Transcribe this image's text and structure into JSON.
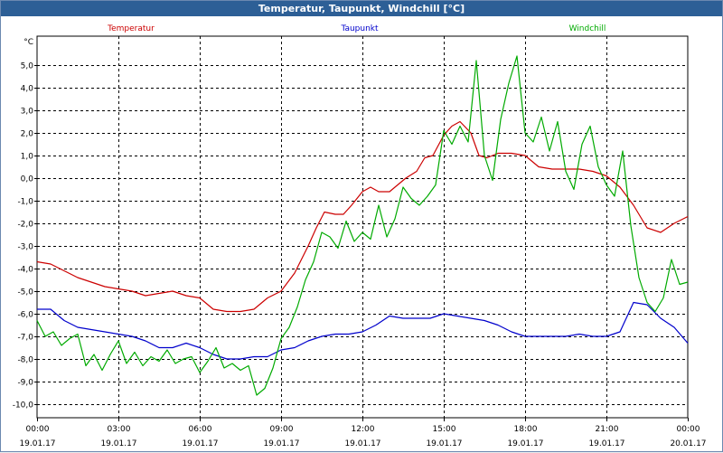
{
  "window": {
    "title": "Temperatur, Taupunkt, Windchill [°C]"
  },
  "chart_data": {
    "type": "line",
    "unit_label": "°C",
    "ylim": [
      -10.5,
      6
    ],
    "yticks": [
      5.0,
      4.0,
      3.0,
      2.0,
      1.0,
      0.0,
      -1.0,
      -2.0,
      -3.0,
      -4.0,
      -5.0,
      -6.0,
      -7.0,
      -8.0,
      -9.0,
      -10.0
    ],
    "ytick_labels": [
      "5,0",
      "4,0",
      "3,0",
      "2,0",
      "1,0",
      "0,0",
      "-1,0",
      "-2,0",
      "-3,0",
      "-4,0",
      "-5,0",
      "-6,0",
      "-7,0",
      "-8,0",
      "-9,0",
      "-10,0"
    ],
    "xlim": [
      0,
      24
    ],
    "xticks": [
      0,
      3,
      6,
      9,
      12,
      15,
      18,
      21,
      24
    ],
    "xtick_times": [
      "00:00",
      "03:00",
      "06:00",
      "09:00",
      "12:00",
      "15:00",
      "18:00",
      "21:00",
      "00:00"
    ],
    "xtick_dates": [
      "19.01.17",
      "19.01.17",
      "19.01.17",
      "19.01.17",
      "19.01.17",
      "19.01.17",
      "19.01.17",
      "19.01.17",
      "20.01.17"
    ],
    "grid": true,
    "legend_position": "top",
    "series": [
      {
        "name": "Temperatur",
        "color": "#cc0000",
        "x": [
          0,
          0.5,
          1,
          1.5,
          2,
          2.5,
          3,
          3.5,
          4,
          4.5,
          5,
          5.5,
          6,
          6.5,
          7,
          7.5,
          8,
          8.5,
          9,
          9.5,
          10,
          10.3,
          10.6,
          11,
          11.3,
          11.6,
          12,
          12.3,
          12.6,
          13,
          13.3,
          13.6,
          14,
          14.3,
          14.6,
          15,
          15.3,
          15.6,
          16,
          16.3,
          16.6,
          17,
          17.5,
          18,
          18.5,
          19,
          19.5,
          20,
          20.5,
          21,
          21.5,
          22,
          22.5,
          23,
          23.5,
          24
        ],
        "values": [
          -3.7,
          -3.8,
          -4.1,
          -4.4,
          -4.6,
          -4.8,
          -4.9,
          -5.0,
          -5.2,
          -5.1,
          -5.0,
          -5.2,
          -5.3,
          -5.8,
          -5.9,
          -5.9,
          -5.8,
          -5.3,
          -5.0,
          -4.2,
          -3.0,
          -2.2,
          -1.5,
          -1.6,
          -1.6,
          -1.2,
          -0.6,
          -0.4,
          -0.6,
          -0.6,
          -0.3,
          0.0,
          0.3,
          0.9,
          1.0,
          1.9,
          2.3,
          2.5,
          2.0,
          1.0,
          0.9,
          1.1,
          1.1,
          1.0,
          0.5,
          0.4,
          0.4,
          0.4,
          0.3,
          0.1,
          -0.4,
          -1.2,
          -2.2,
          -2.4,
          -2.0,
          -1.7
        ]
      },
      {
        "name": "Taupunkt",
        "color": "#0000cc",
        "x": [
          0,
          0.5,
          1,
          1.5,
          2,
          2.5,
          3,
          3.5,
          4,
          4.5,
          5,
          5.5,
          6,
          6.5,
          7,
          7.5,
          8,
          8.5,
          9,
          9.5,
          10,
          10.5,
          11,
          11.5,
          12,
          12.5,
          13,
          13.5,
          14,
          14.5,
          15,
          15.5,
          16,
          16.5,
          17,
          17.5,
          18,
          18.5,
          19,
          19.5,
          20,
          20.5,
          21,
          21.5,
          22,
          22.5,
          23,
          23.5,
          24
        ],
        "values": [
          -5.8,
          -5.8,
          -6.3,
          -6.6,
          -6.7,
          -6.8,
          -6.9,
          -7.0,
          -7.2,
          -7.5,
          -7.5,
          -7.3,
          -7.5,
          -7.8,
          -8.0,
          -8.0,
          -7.9,
          -7.9,
          -7.6,
          -7.5,
          -7.2,
          -7.0,
          -6.9,
          -6.9,
          -6.8,
          -6.5,
          -6.1,
          -6.2,
          -6.2,
          -6.2,
          -6.0,
          -6.1,
          -6.2,
          -6.3,
          -6.5,
          -6.8,
          -7.0,
          -7.0,
          -7.0,
          -7.0,
          -6.9,
          -7.0,
          -7.0,
          -6.8,
          -5.5,
          -5.6,
          -6.2,
          -6.6,
          -7.3
        ]
      },
      {
        "name": "Windchill",
        "color": "#00aa00",
        "x": [
          0,
          0.3,
          0.6,
          0.9,
          1.2,
          1.5,
          1.8,
          2.1,
          2.4,
          2.7,
          3.0,
          3.3,
          3.6,
          3.9,
          4.2,
          4.5,
          4.8,
          5.1,
          5.4,
          5.7,
          6.0,
          6.3,
          6.6,
          6.9,
          7.2,
          7.5,
          7.8,
          8.1,
          8.4,
          8.7,
          9.0,
          9.3,
          9.6,
          9.9,
          10.2,
          10.5,
          10.8,
          11.1,
          11.4,
          11.7,
          12.0,
          12.3,
          12.6,
          12.9,
          13.2,
          13.5,
          13.8,
          14.1,
          14.4,
          14.7,
          15.0,
          15.3,
          15.6,
          15.9,
          16.2,
          16.5,
          16.8,
          17.1,
          17.4,
          17.7,
          18.0,
          18.3,
          18.6,
          18.9,
          19.2,
          19.5,
          19.8,
          20.1,
          20.4,
          20.7,
          21.0,
          21.3,
          21.6,
          21.9,
          22.2,
          22.5,
          22.8,
          23.1,
          23.4,
          23.7,
          24.0
        ],
        "values": [
          -6.3,
          -7.0,
          -6.8,
          -7.4,
          -7.1,
          -6.9,
          -8.3,
          -7.8,
          -8.5,
          -7.8,
          -7.2,
          -8.2,
          -7.7,
          -8.3,
          -7.9,
          -8.1,
          -7.6,
          -8.2,
          -8.0,
          -7.9,
          -8.6,
          -8.1,
          -7.5,
          -8.4,
          -8.2,
          -8.5,
          -8.3,
          -9.6,
          -9.3,
          -8.4,
          -7.1,
          -6.6,
          -5.7,
          -4.5,
          -3.7,
          -2.4,
          -2.6,
          -3.1,
          -1.9,
          -2.8,
          -2.4,
          -2.7,
          -1.2,
          -2.6,
          -1.8,
          -0.4,
          -0.9,
          -1.2,
          -0.8,
          -0.3,
          2.1,
          1.5,
          2.3,
          1.6,
          5.2,
          1.0,
          -0.1,
          2.6,
          4.2,
          5.4,
          2.0,
          1.6,
          2.7,
          1.2,
          2.5,
          0.3,
          -0.5,
          1.5,
          2.3,
          0.5,
          -0.3,
          -0.8,
          1.2,
          -2.1,
          -4.4,
          -5.5,
          -5.9,
          -5.3,
          -3.6,
          -4.7,
          -4.6
        ]
      }
    ]
  }
}
